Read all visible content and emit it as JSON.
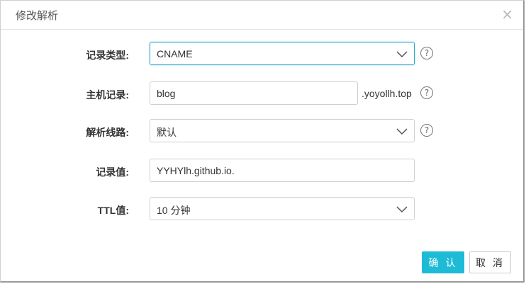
{
  "dialog": {
    "title": "修改解析",
    "close_label": "×"
  },
  "form": {
    "record_type": {
      "label": "记录类型:",
      "value": "CNAME"
    },
    "host": {
      "label": "主机记录:",
      "value": "blog",
      "suffix": ".yoyollh.top"
    },
    "line": {
      "label": "解析线路:",
      "value": "默认"
    },
    "record_value": {
      "label": "记录值:",
      "value": "YYHYlh.github.io."
    },
    "ttl": {
      "label": "TTL值:",
      "value": "10 分钟"
    },
    "help_label": "?"
  },
  "buttons": {
    "confirm": "确 认",
    "cancel": "取 消"
  },
  "colors": {
    "accent": "#1ebbd7",
    "focus_border": "#26a6c8"
  },
  "icons": [
    "close-icon",
    "chevron-down-icon",
    "help-icon"
  ]
}
